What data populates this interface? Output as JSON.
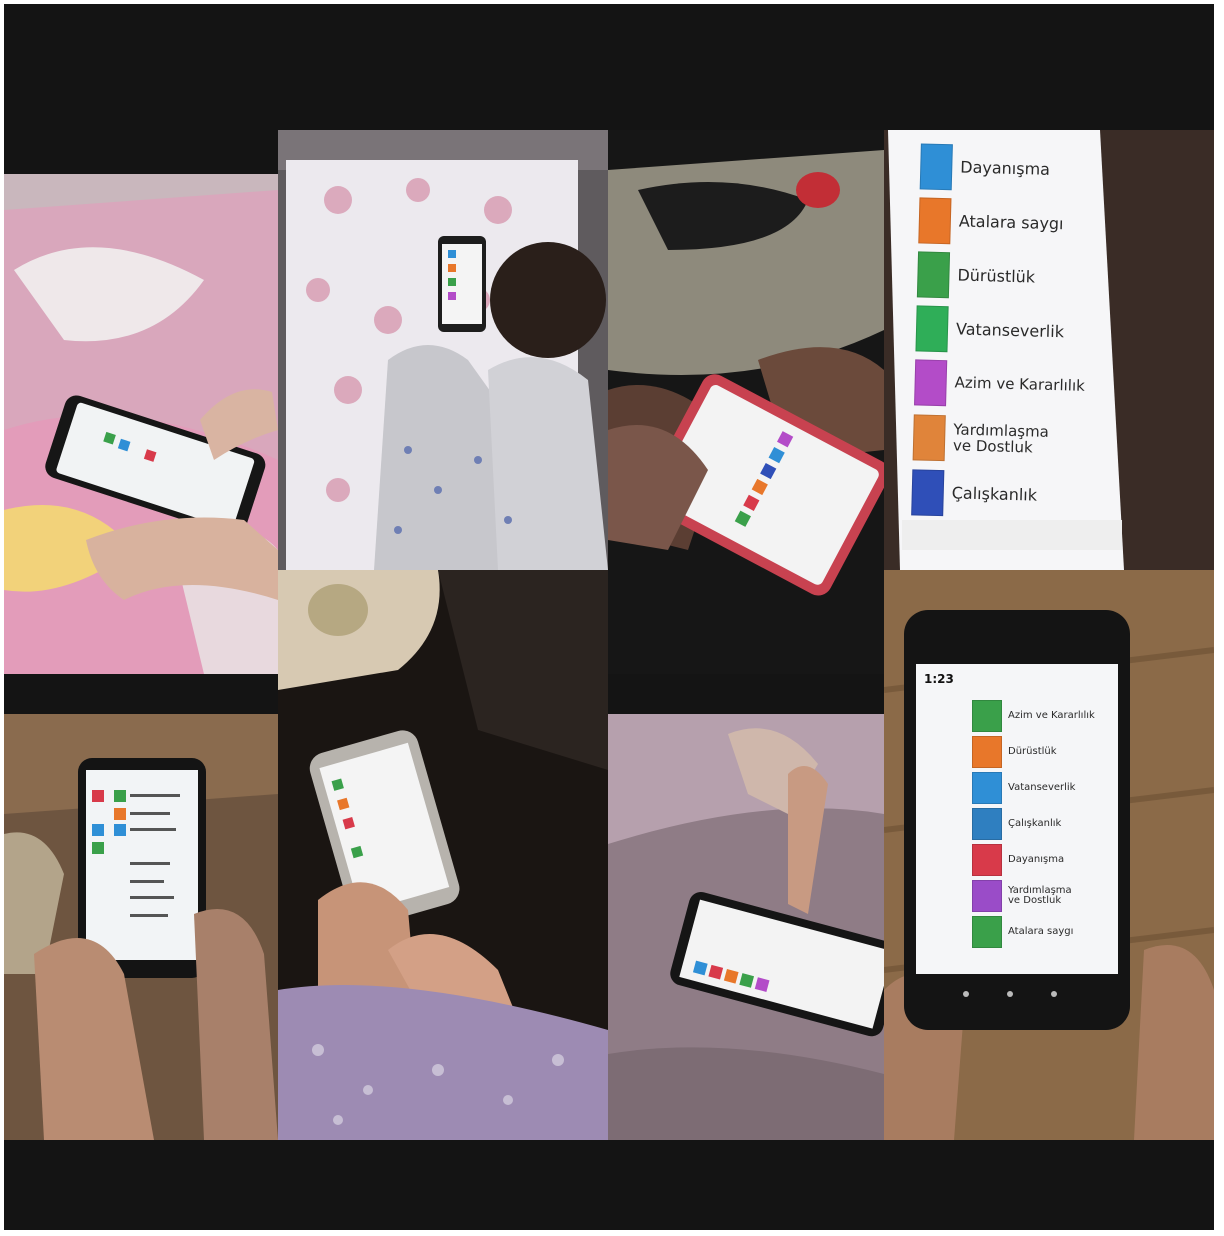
{
  "screen_b": {
    "items": [
      {
        "label": "Dayanışma",
        "color": "#2f8fd6"
      },
      {
        "label": "Atalara saygı",
        "color": "#e8772a"
      },
      {
        "label": "Dürüstlük",
        "color": "#3aa04a"
      },
      {
        "label": "Vatanseverlik",
        "color": "#2fae58"
      },
      {
        "label": "Azim ve Kararlılık",
        "color": "#b34cc8"
      },
      {
        "label": "Yardımlaşma\nve Dostluk",
        "color": "#e0843a"
      },
      {
        "label": "Çalışkanlık",
        "color": "#2f4fb8"
      }
    ]
  },
  "screen_h": {
    "time": "1:23",
    "items": [
      {
        "label": "Azim ve Kararlılık",
        "color": "#3aa04a"
      },
      {
        "label": "Dürüstlük",
        "color": "#e8772a"
      },
      {
        "label": "Vatanseverlik",
        "color": "#2f8fd6"
      },
      {
        "label": "Çalışkanlık",
        "color": "#2f7fc0"
      },
      {
        "label": "Dayanışma",
        "color": "#d83a4a"
      },
      {
        "label": "Yardımlaşma\nve Dostluk",
        "color": "#9a4cc8"
      },
      {
        "label": "Atalara saygı",
        "color": "#3aa04a"
      }
    ]
  }
}
